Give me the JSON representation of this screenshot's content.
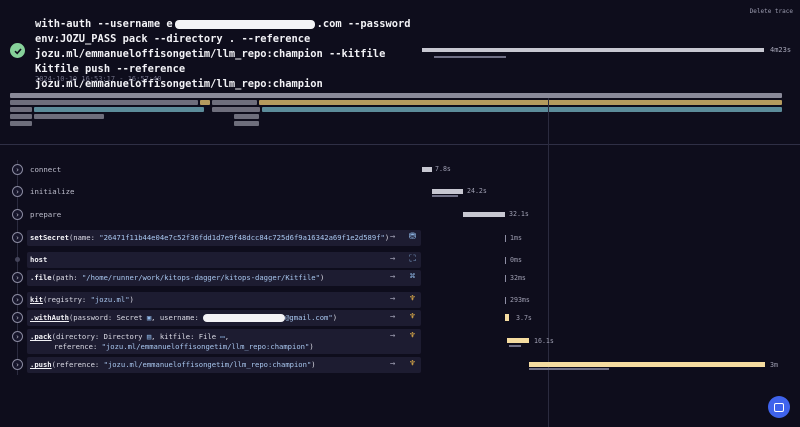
{
  "header": {
    "command_part1": "with-auth --username e",
    "command_part2": ".com --password env:JOZU_PASS pack --directory . --reference jozu.ml/emmanueloffisongetim/llm_repo:champion --kitfile Kitfile push --reference jozu.ml/emmanueloffisongetim/llm_repo:champion",
    "timestamp": "2024-10-10 16:53:17 - 16:57:40",
    "delete_label": "Delete trace",
    "duration": "4m23s"
  },
  "steps": [
    {
      "label": "connect",
      "duration": "7.8s"
    },
    {
      "label": "initialize",
      "duration": "24.2s"
    },
    {
      "label": "prepare",
      "duration": "32.1s"
    }
  ],
  "calls": {
    "setsecret": {
      "fn": "setSecret",
      "pre": "(name: ",
      "arg": "\"26471f11b44e04e7c52f36fdd1d7e9f48dcc84c725d6f9a16342a69f1e2d589f\"",
      "post": ")",
      "duration": "1ms"
    },
    "host": {
      "fn": "host",
      "duration": "0ms"
    },
    "file": {
      "fn": ".file",
      "pre": "(path: ",
      "arg": "\"/home/runner/work/kitops-dagger/kitops-dagger/Kitfile\"",
      "post": ")",
      "duration": "32ms"
    },
    "kit": {
      "fn": "kit",
      "pre": "(registry: ",
      "arg": "\"jozu.ml\"",
      "post": ")",
      "duration": "293ms"
    },
    "withauth": {
      "fn": ".withAuth",
      "pre": "(password: Secret ",
      "mid": ", username: ",
      "arg_end": "@gmail.com\"",
      "post": ")",
      "duration": "3.7s"
    },
    "pack": {
      "fn": ".pack",
      "pre": "(directory: Directory ",
      "mid": ", kitfile: File ",
      "post": ",",
      "line2_pre": "reference: ",
      "arg": "\"jozu.ml/emmanueloffisongetim/llm_repo:champion\"",
      "line2_post": ")",
      "duration": "16.1s"
    },
    "push": {
      "fn": ".push",
      "pre": "(reference: ",
      "arg": "\"jozu.ml/emmanueloffisongetim/llm_repo:champion\"",
      "post": ")",
      "duration": "3m"
    }
  },
  "icons": {
    "success": "check-circle-icon",
    "secret": "lock-icon",
    "directory": "folder-icon",
    "file": "file-icon",
    "arrow": "arrow-right-icon"
  },
  "colors": {
    "accent_bar": "#f5dca0",
    "success": "#86d19a",
    "chat": "#3f63ec"
  }
}
